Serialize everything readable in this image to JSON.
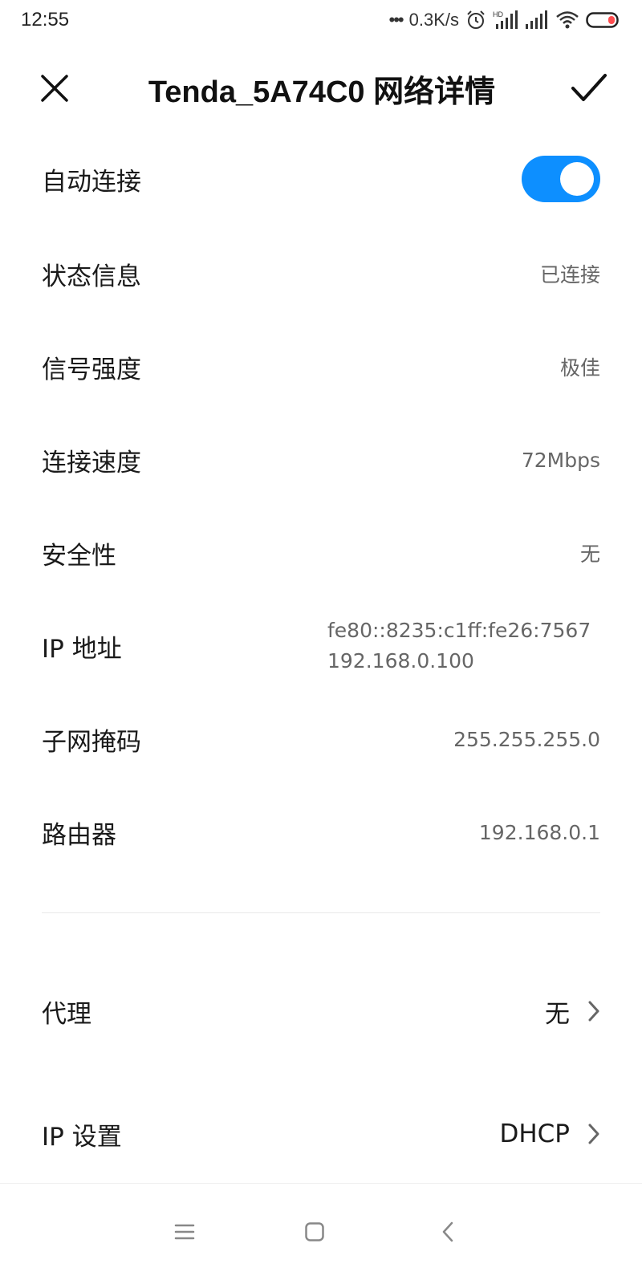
{
  "status_bar": {
    "time": "12:55",
    "dots": "•••",
    "net_speed": "0.3K/s",
    "hd_label": "HD",
    "icons": [
      "alarm-icon",
      "hd-signal-icon",
      "signal-icon",
      "wifi-icon",
      "battery-icon"
    ]
  },
  "title_bar": {
    "title": "Tenda_5A74C0 网络详情",
    "close_icon": "close-icon",
    "confirm_icon": "check-icon"
  },
  "rows": {
    "auto_connect": {
      "label": "自动连接",
      "enabled": true
    },
    "status": {
      "label": "状态信息",
      "value": "已连接"
    },
    "signal": {
      "label": "信号强度",
      "value": "极佳"
    },
    "speed": {
      "label": "连接速度",
      "value": "72Mbps"
    },
    "security": {
      "label": "安全性",
      "value": "无"
    },
    "ip": {
      "label": "IP 地址",
      "values": [
        "fe80::8235:c1ff:fe26:7567",
        "192.168.0.100"
      ]
    },
    "subnet": {
      "label": "子网掩码",
      "value": "255.255.255.0"
    },
    "router": {
      "label": "路由器",
      "value": "192.168.0.1"
    }
  },
  "links": {
    "proxy": {
      "label": "代理",
      "value": "无"
    },
    "ip_settings": {
      "label": "IP 设置",
      "value": "DHCP"
    }
  },
  "nav_bar": {
    "icons": [
      "menu-icon",
      "home-icon",
      "back-icon"
    ]
  },
  "colors": {
    "accent": "#0d8fff",
    "battery_low": "#ff4d4f"
  }
}
